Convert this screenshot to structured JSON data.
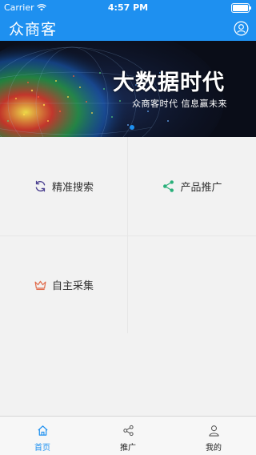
{
  "status_bar": {
    "carrier": "Carrier",
    "time": "4:57 PM"
  },
  "nav": {
    "title": "众商客",
    "right_icon": "user-icon"
  },
  "banner": {
    "title": "大数据时代",
    "subtitle": "众商客时代  信息赢未来"
  },
  "grid": {
    "items": [
      {
        "label": "精准搜索",
        "icon": "refresh-icon",
        "color": "#4a3f8f"
      },
      {
        "label": "产品推广",
        "icon": "share-icon",
        "color": "#2ab07a"
      },
      {
        "label": "自主采集",
        "icon": "crown-icon",
        "color": "#e06a4a"
      }
    ]
  },
  "tabbar": {
    "tabs": [
      {
        "label": "首页",
        "icon": "home-icon",
        "active": true
      },
      {
        "label": "推广",
        "icon": "share-icon",
        "active": false
      },
      {
        "label": "我的",
        "icon": "profile-icon",
        "active": false
      }
    ]
  },
  "colors": {
    "primary": "#1e90f0",
    "tab_active": "#1e90f0"
  }
}
